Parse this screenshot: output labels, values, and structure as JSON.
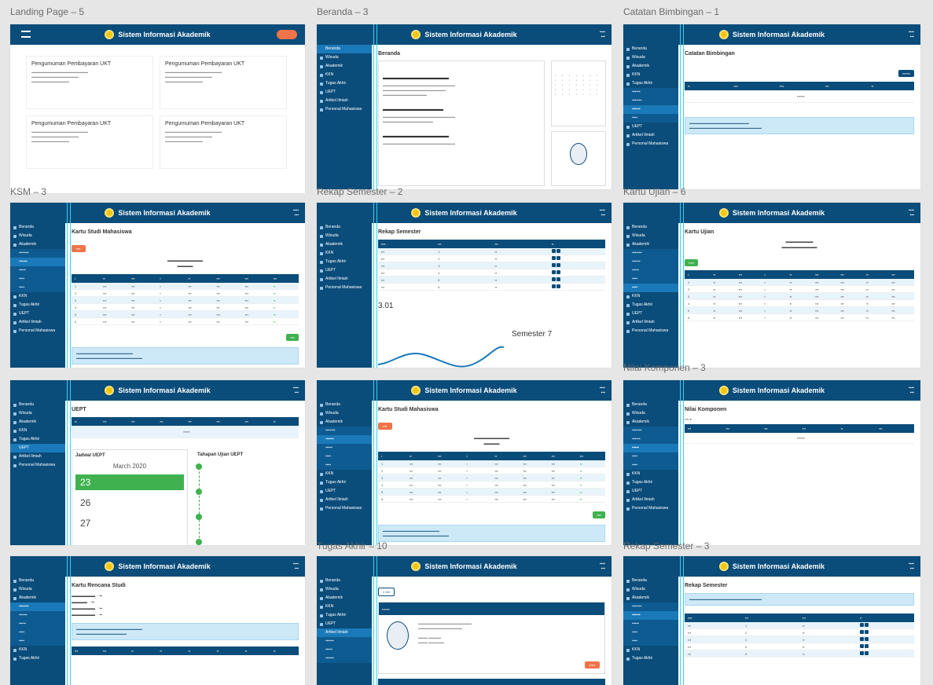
{
  "app_title": "Sistem Informasi Akademik",
  "frames": {
    "landing": {
      "label": "Landing Page – 5"
    },
    "beranda": {
      "label": "Beranda – 3",
      "title": "Beranda"
    },
    "catatan": {
      "label": "Catatan Bimbingan – 1",
      "title": "Catatan Bimbingan"
    },
    "ksm3": {
      "label": "KSM – 3",
      "title": "Kartu Studi Mahasiswa"
    },
    "rekap2": {
      "label": "Rekap Semester – 2",
      "title": "Rekap Semester",
      "ip": "3.01",
      "semester": "Semester 7"
    },
    "ujian": {
      "label": "Kartu Ujian – 6",
      "title": "Kartu Ujian"
    },
    "uept": {
      "title": "UEPT",
      "calendar_title": "Jadwal UEPT",
      "calendar_month": "March 2020",
      "stages_title": "Tahapan Ujian UEPT",
      "days": [
        "23",
        "26",
        "27"
      ]
    },
    "ksm4": {
      "title": "Kartu Studi Mahasiswa"
    },
    "nilai": {
      "label": "Nilai Komponen – 3",
      "title": "Nilai Komponen"
    },
    "ksmm": {
      "title": "Kartu Rencana Studi"
    },
    "tugas": {
      "label": "Tugas Akhir – 10"
    },
    "rekap3": {
      "label": "Rekap Semester – 3",
      "title": "Rekap Semester"
    }
  },
  "landing_card_title": "Pengumuman Pembayaran UKT",
  "sidebar": [
    "Beranda",
    "Wisuda",
    "Akademik",
    "KKN",
    "Tugas Akhir",
    "UEPT",
    "Artikel Ilmiah",
    "Personal Mahasiswa"
  ]
}
